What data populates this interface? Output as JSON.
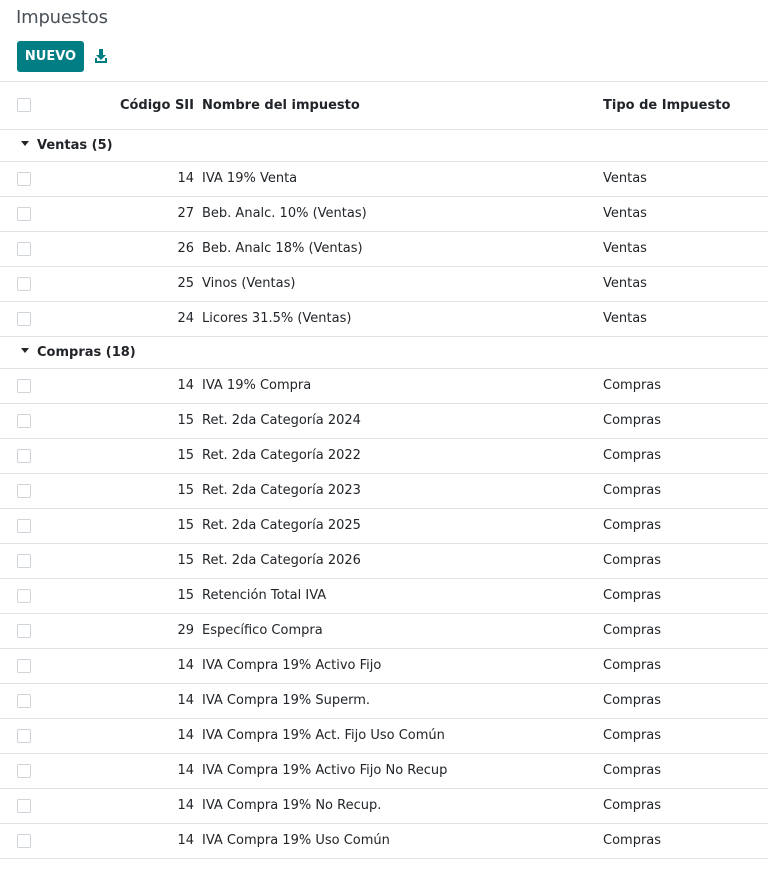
{
  "page": {
    "title": "Impuestos",
    "new_button_label": "NUEVO",
    "accent_color": "#017e84"
  },
  "icons": {
    "download": "download-icon",
    "group_toggle": "caret-down-icon"
  },
  "table": {
    "columns": {
      "code": "Código SII",
      "name": "Nombre del impuesto",
      "type": "Tipo de Impuesto"
    },
    "groups": [
      {
        "label": "Ventas (5)",
        "rows": [
          {
            "code": "14",
            "name": "IVA 19% Venta",
            "type": "Ventas"
          },
          {
            "code": "27",
            "name": "Beb. Analc. 10% (Ventas)",
            "type": "Ventas"
          },
          {
            "code": "26",
            "name": "Beb. Analc 18% (Ventas)",
            "type": "Ventas"
          },
          {
            "code": "25",
            "name": "Vinos (Ventas)",
            "type": "Ventas"
          },
          {
            "code": "24",
            "name": "Licores 31.5% (Ventas)",
            "type": "Ventas"
          }
        ]
      },
      {
        "label": "Compras (18)",
        "rows": [
          {
            "code": "14",
            "name": "IVA 19% Compra",
            "type": "Compras"
          },
          {
            "code": "15",
            "name": "Ret. 2da Categoría 2024",
            "type": "Compras"
          },
          {
            "code": "15",
            "name": "Ret. 2da Categoría 2022",
            "type": "Compras"
          },
          {
            "code": "15",
            "name": "Ret. 2da Categoría 2023",
            "type": "Compras"
          },
          {
            "code": "15",
            "name": "Ret. 2da Categoría 2025",
            "type": "Compras"
          },
          {
            "code": "15",
            "name": "Ret. 2da Categoría 2026",
            "type": "Compras"
          },
          {
            "code": "15",
            "name": "Retención Total IVA",
            "type": "Compras"
          },
          {
            "code": "29",
            "name": "Específico Compra",
            "type": "Compras"
          },
          {
            "code": "14",
            "name": "IVA Compra 19% Activo Fijo",
            "type": "Compras"
          },
          {
            "code": "14",
            "name": "IVA Compra 19% Superm.",
            "type": "Compras"
          },
          {
            "code": "14",
            "name": "IVA Compra 19% Act. Fijo Uso Común",
            "type": "Compras"
          },
          {
            "code": "14",
            "name": "IVA Compra 19% Activo Fijo No Recup",
            "type": "Compras"
          },
          {
            "code": "14",
            "name": "IVA Compra 19% No Recup.",
            "type": "Compras"
          },
          {
            "code": "14",
            "name": "IVA Compra 19% Uso Común",
            "type": "Compras"
          }
        ]
      }
    ]
  }
}
